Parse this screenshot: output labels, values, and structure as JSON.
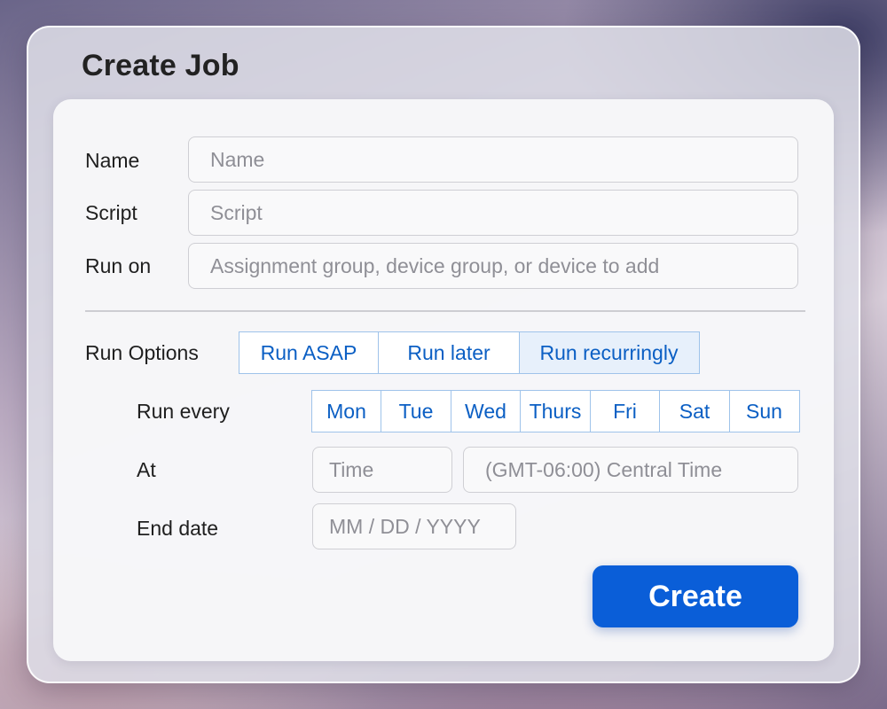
{
  "window": {
    "title": "Create Job"
  },
  "form": {
    "name_label": "Name",
    "name_placeholder": "Name",
    "script_label": "Script",
    "script_placeholder": "Script",
    "run_on_label": "Run on",
    "run_on_placeholder": "Assignment group, device group, or device to add",
    "run_options_label": "Run Options",
    "run_options": [
      "Run ASAP",
      "Run later",
      "Run recurringly"
    ],
    "run_options_selected": "Run recurringly",
    "run_every_label": "Run every",
    "days": [
      "Mon",
      "Tue",
      "Wed",
      "Thurs",
      "Fri",
      "Sat",
      "Sun"
    ],
    "at_label": "At",
    "time_placeholder": "Time",
    "timezone_placeholder": "(GMT-06:00) Central Time",
    "end_date_label": "End date",
    "end_date_placeholder": "MM / DD / YYYY",
    "create_label": "Create"
  },
  "colors": {
    "accent": "#0a5ed8",
    "link": "#0b5fc4",
    "selected_bg": "#e7f0fb"
  }
}
